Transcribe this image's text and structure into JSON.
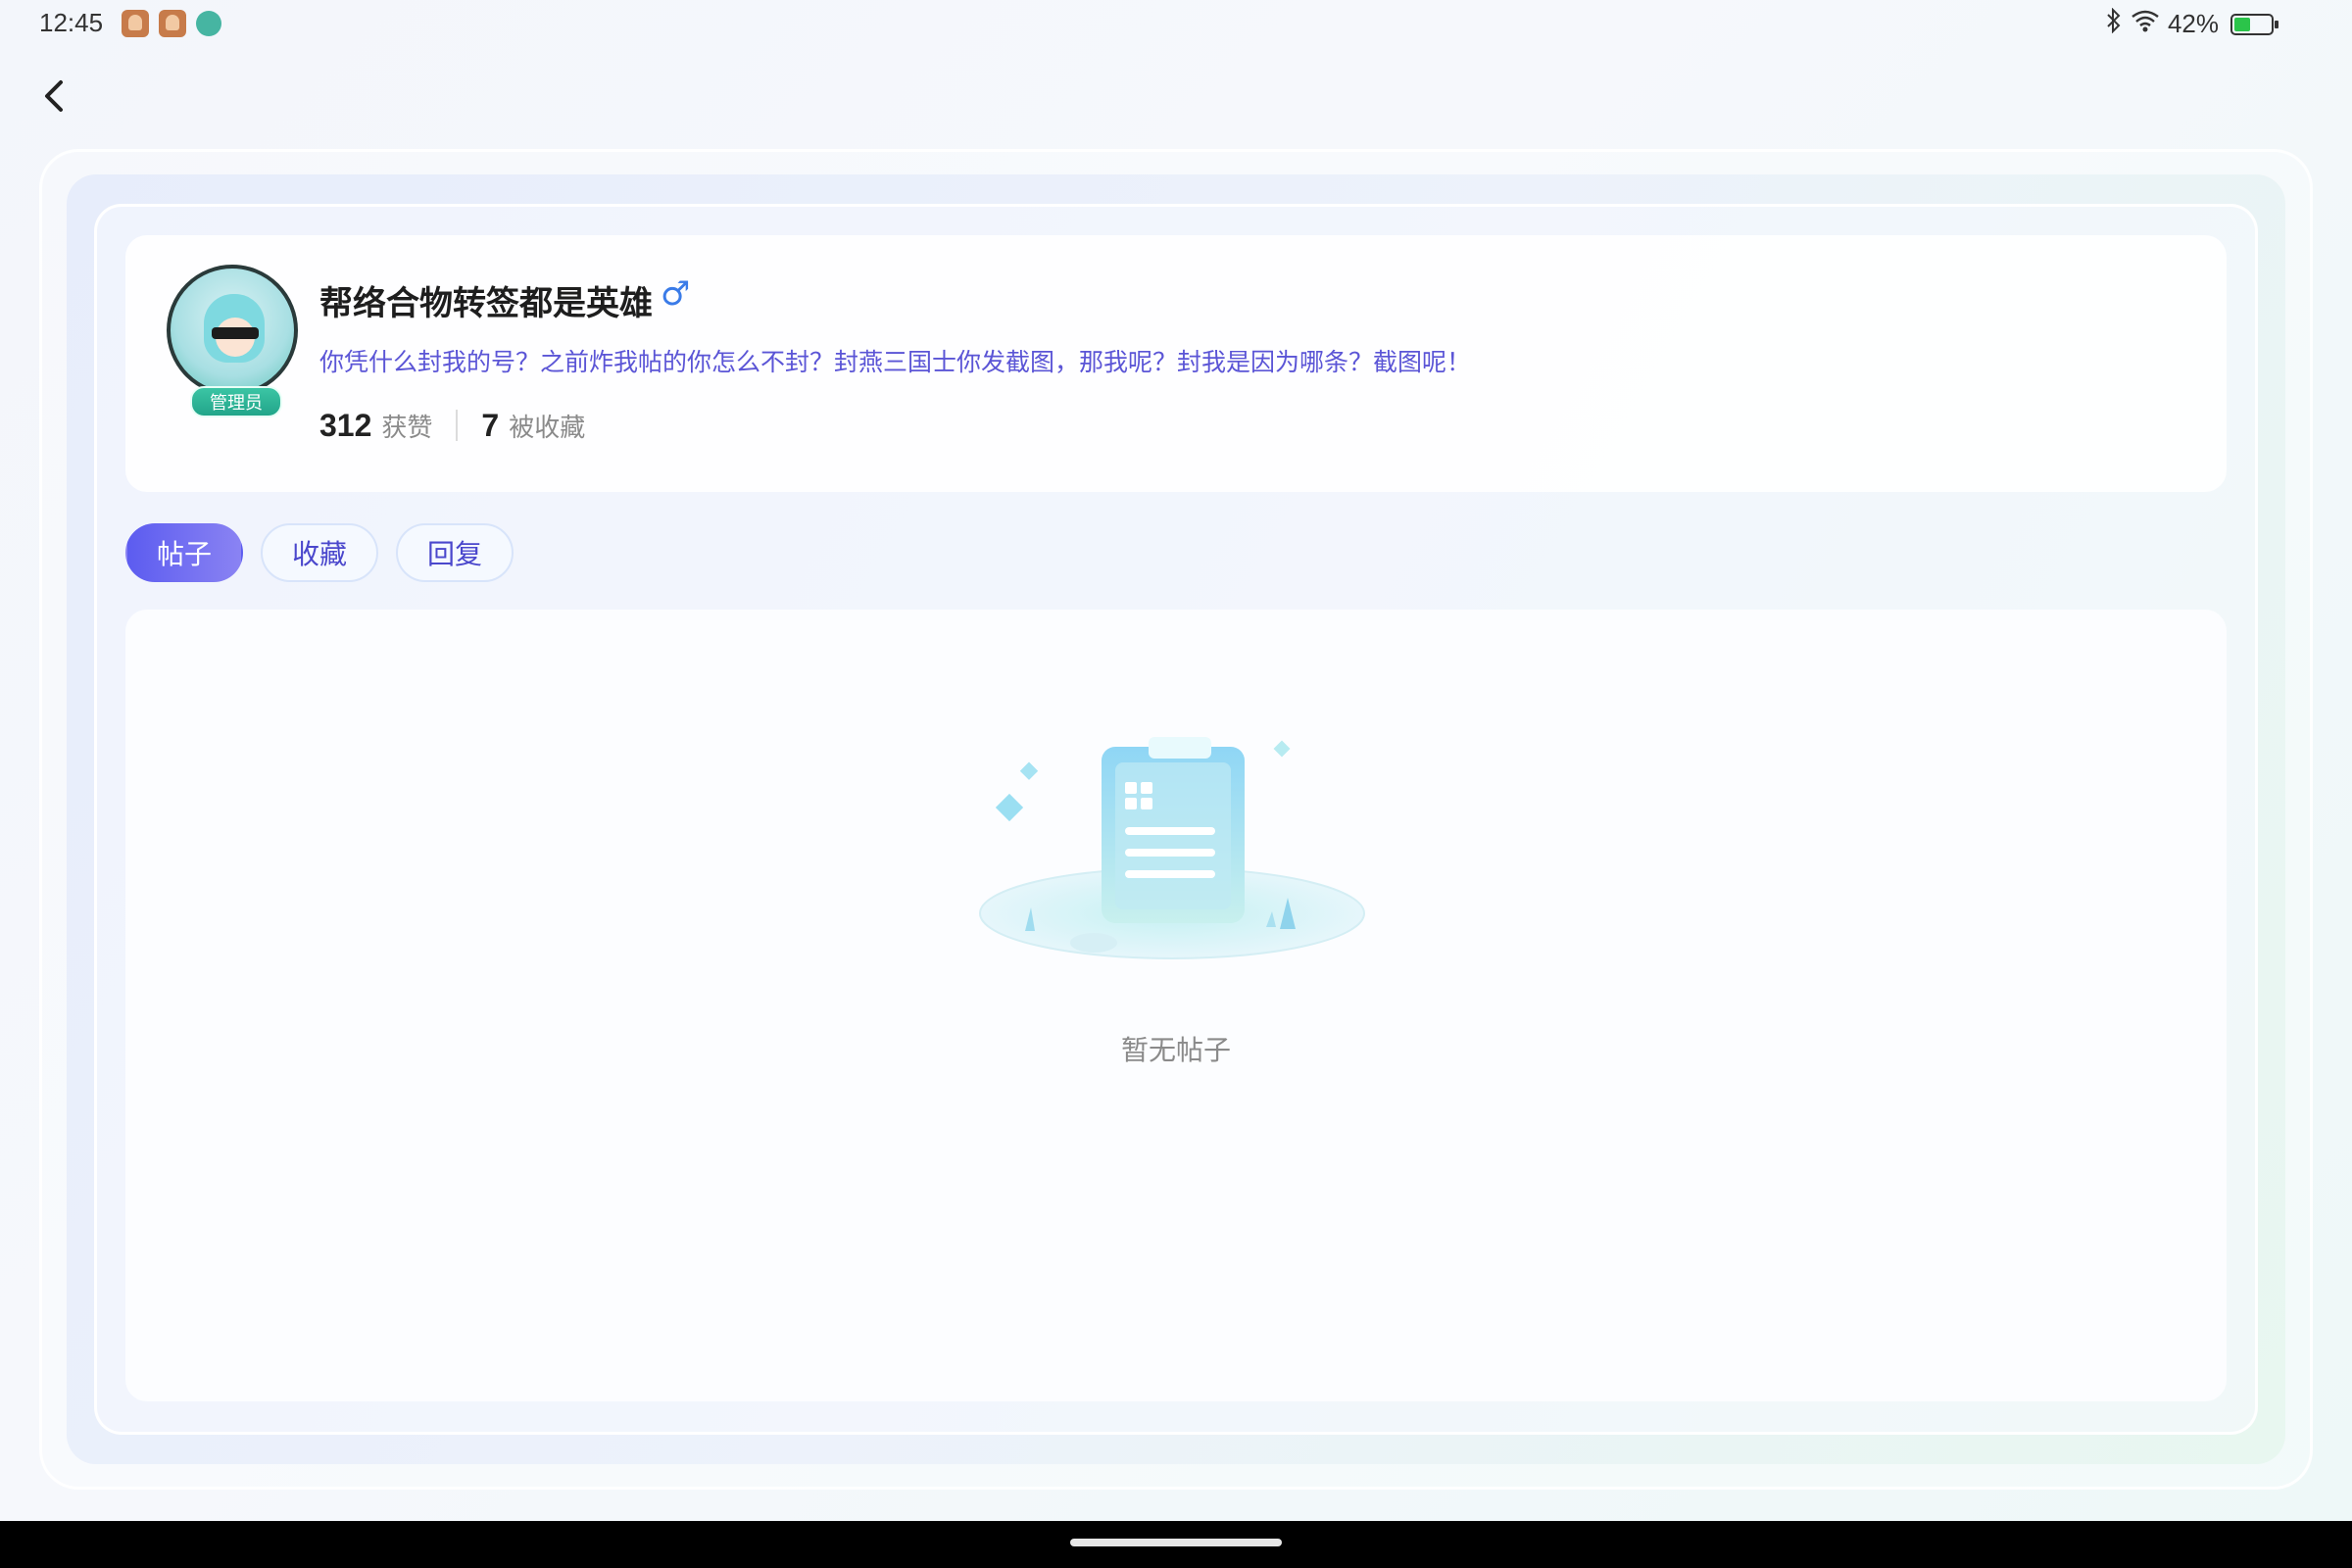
{
  "status_bar": {
    "time": "12:45",
    "battery": "42%",
    "battery_level": 0.42,
    "icons": [
      "notification-avatar-icon",
      "notification-avatar-icon",
      "notification-app-icon",
      "bluetooth-icon",
      "wifi-icon",
      "battery-icon"
    ]
  },
  "profile": {
    "username": "帮络合物转签都是英雄",
    "gender_symbol": "♂",
    "badge": "管理员",
    "bio": "你凭什么封我的号？之前炸我帖的你怎么不封？封燕三国士你发截图，那我呢？封我是因为哪条？截图呢！",
    "likes_count": "312",
    "likes_label": "获赞",
    "favorited_count": "7",
    "favorited_label": "被收藏"
  },
  "tabs": [
    {
      "label": "帖子",
      "active": true
    },
    {
      "label": "收藏",
      "active": false
    },
    {
      "label": "回复",
      "active": false
    }
  ],
  "empty_state": {
    "message": "暂无帖子",
    "icon": "empty-clipboard-icon"
  },
  "colors": {
    "accent": "#5c5cf0",
    "bio_text": "#5b55d6",
    "gender": "#3a7be8",
    "badge": "#22a58a"
  }
}
